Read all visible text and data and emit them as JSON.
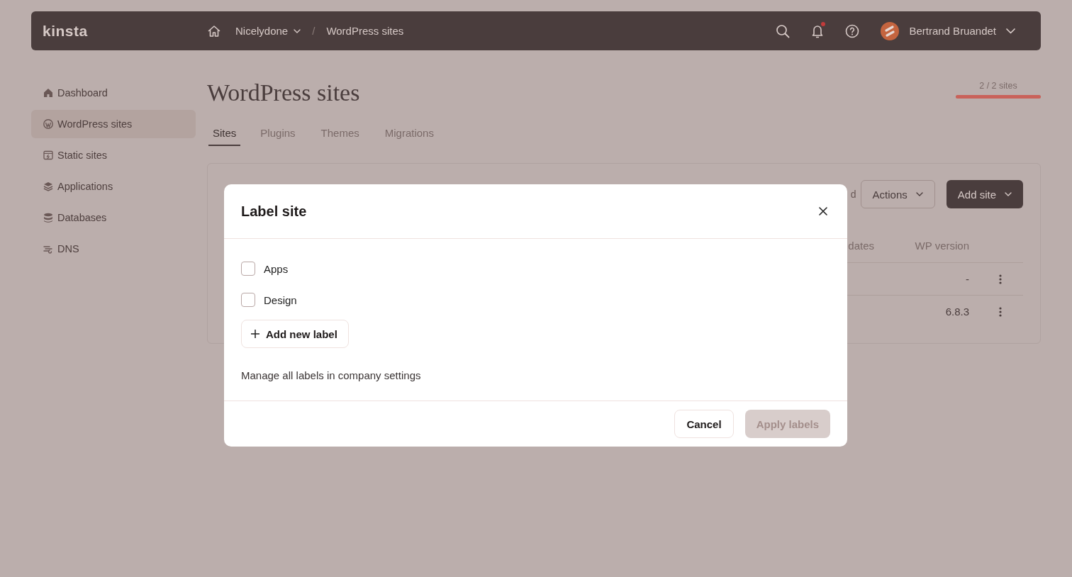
{
  "topbar": {
    "logo": "kinsta",
    "breadcrumb": [
      {
        "label": "Nicelydone",
        "dropdown": true
      },
      {
        "label": "WordPress sites",
        "dropdown": false
      }
    ],
    "separator": "/",
    "notifications_unread": true,
    "user": {
      "name": "Bertrand Bruandet"
    }
  },
  "sidebar": {
    "items": [
      {
        "label": "Dashboard",
        "selected": false
      },
      {
        "label": "WordPress sites",
        "selected": true
      },
      {
        "label": "Static sites",
        "selected": false
      },
      {
        "label": "Applications",
        "selected": false
      },
      {
        "label": "Databases",
        "selected": false
      },
      {
        "label": "DNS",
        "selected": false
      }
    ]
  },
  "page": {
    "title": "WordPress sites",
    "usage": {
      "text": "2 / 2 sites",
      "level": 1
    },
    "tabs": [
      {
        "label": "Sites",
        "selected": true
      },
      {
        "label": "Plugins",
        "selected": false
      },
      {
        "label": "Themes",
        "selected": false
      },
      {
        "label": "Migrations",
        "selected": false
      }
    ]
  },
  "sites_panel": {
    "toolbar_text": "d",
    "actions_button": "Actions",
    "add_button": "Add site",
    "columns": [
      "dates",
      "WP version"
    ],
    "rows": [
      {
        "wp_version": "-"
      },
      {
        "wp_version": "6.8.3"
      }
    ]
  },
  "dialog": {
    "title": "Label site",
    "labels": [
      {
        "label": "Apps",
        "checked": false
      },
      {
        "label": "Design",
        "checked": false
      }
    ],
    "add_label_button": "Add new label",
    "note": "Manage all labels in company settings",
    "cancel_button": "Cancel",
    "apply_button": {
      "label": "Apply labels",
      "disabled": true
    }
  }
}
